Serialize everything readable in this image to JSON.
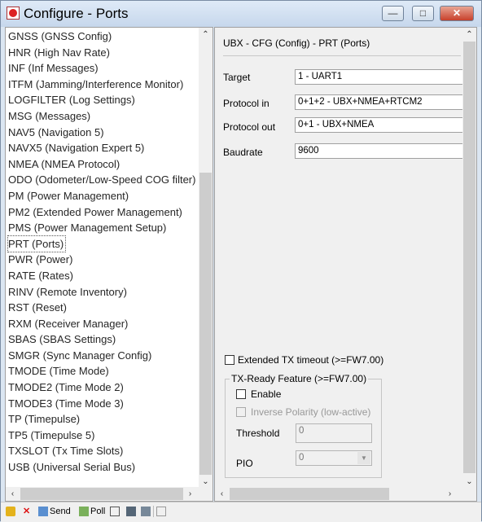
{
  "window": {
    "title": "Configure - Ports",
    "minimize": "—",
    "maximize": "□",
    "close": "✕"
  },
  "sidebar": {
    "items": [
      "GNSS (GNSS Config)",
      "HNR (High Nav Rate)",
      "INF (Inf Messages)",
      "ITFM (Jamming/Interference Monitor)",
      "LOGFILTER (Log Settings)",
      "MSG (Messages)",
      "NAV5 (Navigation 5)",
      "NAVX5 (Navigation Expert 5)",
      "NMEA (NMEA Protocol)",
      "ODO (Odometer/Low-Speed COG filter)",
      "PM (Power Management)",
      "PM2 (Extended Power Management)",
      "PMS (Power Management Setup)",
      "PRT (Ports)",
      "PWR (Power)",
      "RATE (Rates)",
      "RINV (Remote Inventory)",
      "RST (Reset)",
      "RXM (Receiver Manager)",
      "SBAS (SBAS Settings)",
      "SMGR (Sync Manager Config)",
      "TMODE (Time Mode)",
      "TMODE2 (Time Mode 2)",
      "TMODE3 (Time Mode 3)",
      "TP (Timepulse)",
      "TP5 (Timepulse 5)",
      "TXSLOT (Tx Time Slots)",
      "USB (Universal Serial Bus)"
    ],
    "selected": "PRT (Ports)"
  },
  "panel": {
    "heading": "UBX - CFG (Config) - PRT (Ports)",
    "target_label": "Target",
    "target_value": "1 - UART1",
    "protocol_in_label": "Protocol in",
    "protocol_in_value": "0+1+2 - UBX+NMEA+RTCM2",
    "protocol_out_label": "Protocol out",
    "protocol_out_value": "0+1 - UBX+NMEA",
    "baudrate_label": "Baudrate",
    "baudrate_value": "9600",
    "ext_tx_timeout_label": "Extended TX timeout (>=FW7.00)",
    "txready_title": "TX-Ready Feature (>=FW7.00)",
    "enable_label": "Enable",
    "inverse_label": "Inverse Polarity (low-active)",
    "threshold_label": "Threshold",
    "threshold_value": "0",
    "pio_label": "PIO",
    "pio_value": "0"
  },
  "toolbar": {
    "send_label": "Send",
    "poll_label": "Poll"
  },
  "scroll": {
    "left_vertical_position": 0.75,
    "left_horizontal_position": 0.0,
    "right_vertical_position": 0.0,
    "right_horizontal_position": 0.0
  }
}
